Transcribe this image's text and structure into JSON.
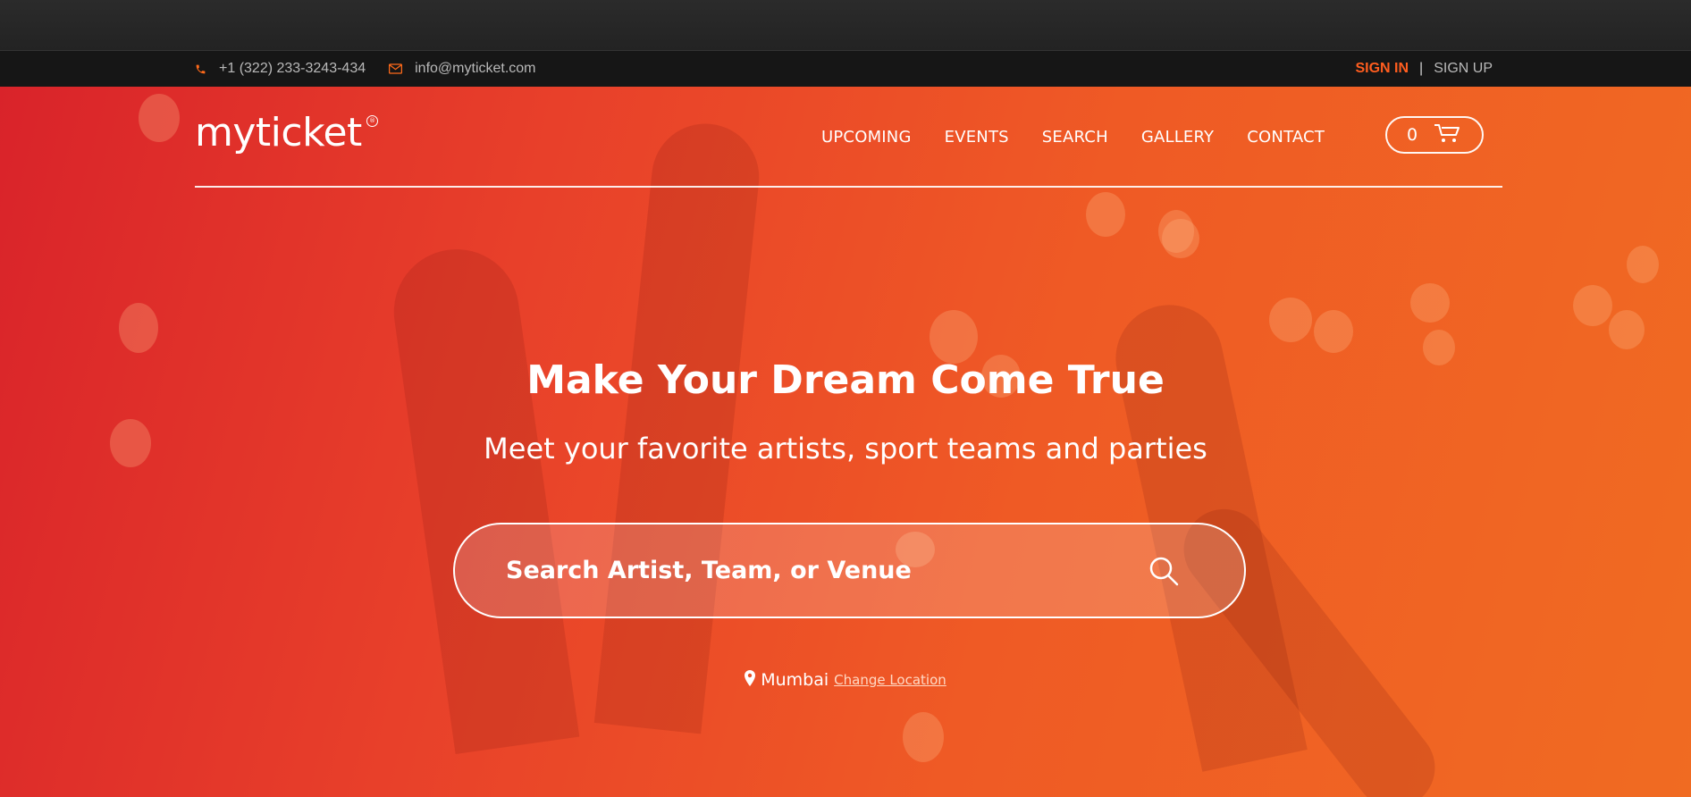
{
  "topbar": {
    "phone": "+1 (322) 233-3243-434",
    "email": "info@myticket.com",
    "sign_in": "SIGN IN",
    "separator": "|",
    "sign_up": "SIGN UP"
  },
  "header": {
    "logo": "myticket",
    "logo_mark": "®",
    "nav": [
      "UPCOMING",
      "EVENTS",
      "SEARCH",
      "GALLERY",
      "CONTACT"
    ],
    "cart_count": "0"
  },
  "hero": {
    "headline": "Make Your Dream Come True",
    "subline": "Meet your favorite artists, sport teams and parties",
    "search_placeholder": "Search Artist, Team, or Venue",
    "city": "Mumbai",
    "change_location": "Change Location"
  },
  "colors": {
    "accent": "#ff5d1f",
    "hero_start": "#d9232a",
    "hero_end": "#f06b22",
    "topbar_bg": "#161616"
  },
  "icons": [
    "phone-icon",
    "envelope-icon",
    "cart-icon",
    "search-icon",
    "map-pin-icon"
  ]
}
